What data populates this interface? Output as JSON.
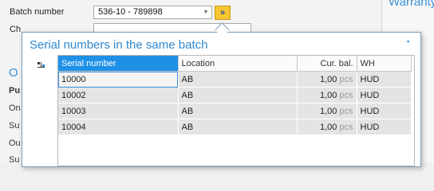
{
  "form": {
    "batch_label": "Batch number",
    "batch_value": "536-10 - 789898",
    "change_label": "Ch",
    "left_letters": [
      "Pu",
      "On",
      "Su",
      "Ou",
      "Su"
    ],
    "section_title_initial": "O",
    "warranty_title": "Warranty"
  },
  "popup": {
    "title": "Serial numbers in the same batch",
    "columns": [
      "Serial number",
      "Location",
      "Cur. bal.",
      "WH"
    ],
    "rows": [
      {
        "serial": "10000",
        "location": "AB",
        "balance": "1,00",
        "unit": "pcs",
        "wh": "HUD"
      },
      {
        "serial": "10002",
        "location": "AB",
        "balance": "1,00",
        "unit": "pcs",
        "wh": "HUD"
      },
      {
        "serial": "10003",
        "location": "AB",
        "balance": "1,00",
        "unit": "pcs",
        "wh": "HUD"
      },
      {
        "serial": "10004",
        "location": "AB",
        "balance": "1,00",
        "unit": "pcs",
        "wh": "HUD"
      }
    ]
  },
  "colors": {
    "accent": "#2f88d0",
    "selected_header": "#1e90e6",
    "lookup_button": "#f7c531"
  }
}
